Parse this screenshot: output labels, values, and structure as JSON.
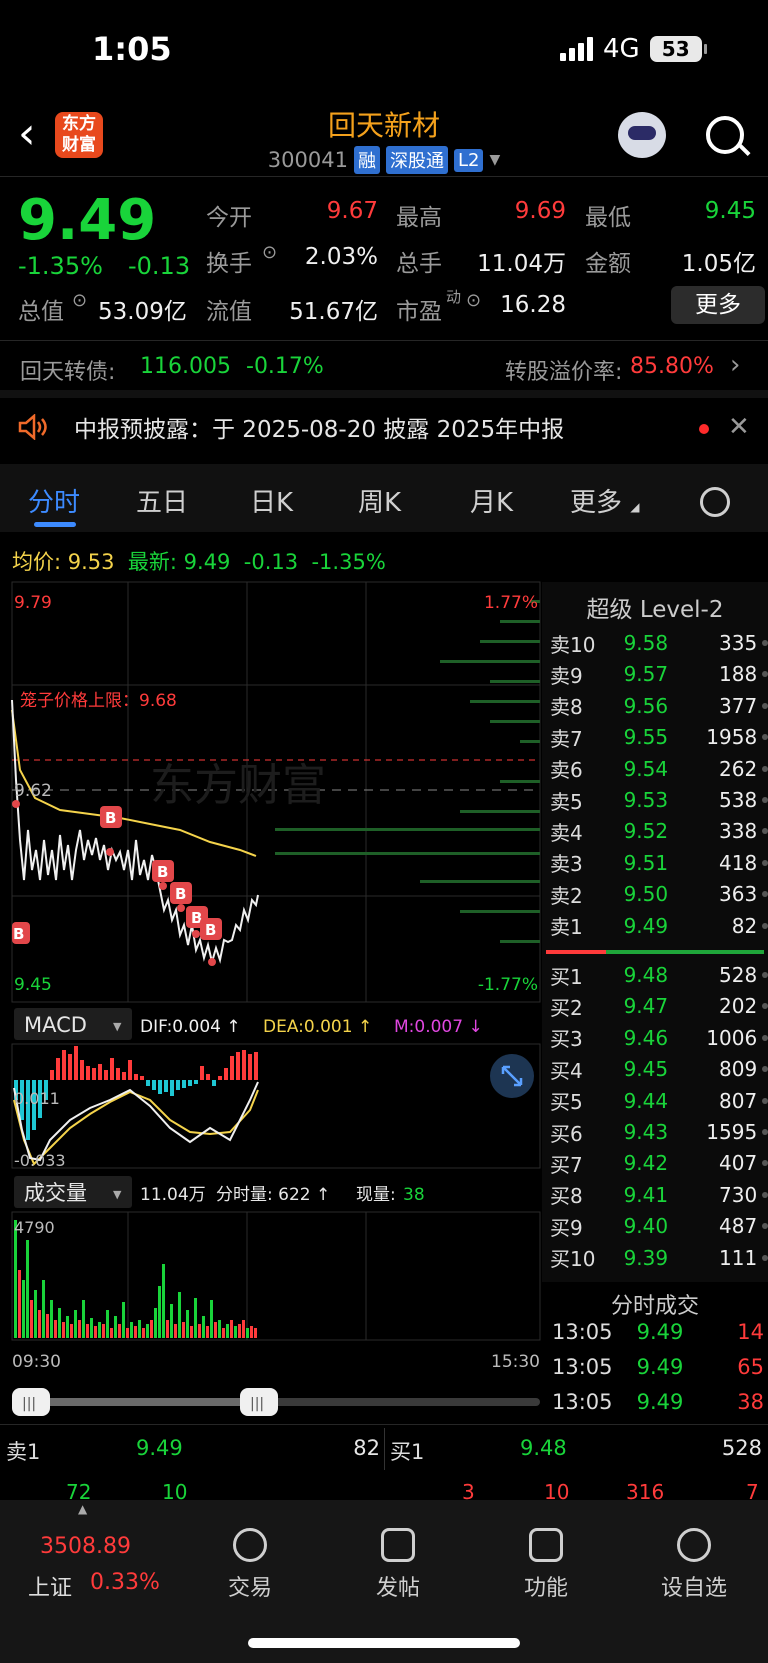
{
  "status": {
    "time": "1:05",
    "network": "4G",
    "battery": "53"
  },
  "header": {
    "title": "回天新材",
    "code": "300041",
    "tags": [
      "融",
      "深股通",
      "L2"
    ],
    "logo_line1": "东方",
    "logo_line2": "财富"
  },
  "quote": {
    "price": "9.49",
    "change_pct": "-1.35%",
    "change": "-0.13",
    "rows": [
      [
        {
          "k": "今开",
          "v": "9.67",
          "c": "red"
        },
        {
          "k": "最高",
          "v": "9.69",
          "c": "red"
        },
        {
          "k": "最低",
          "v": "9.45",
          "c": "green"
        }
      ],
      [
        {
          "k": "换手",
          "v": "2.03%",
          "c": "white"
        },
        {
          "k": "总手",
          "v": "11.04万",
          "c": "white"
        },
        {
          "k": "金额",
          "v": "1.05亿",
          "c": "white"
        }
      ]
    ],
    "row3": {
      "total_value_label": "总值",
      "total_value": "53.09亿",
      "float_label": "流值",
      "float_value": "51.67亿",
      "pe_label": "市盈",
      "pe_sup": "动",
      "pe_value": "16.28"
    },
    "more": "更多"
  },
  "bond": {
    "name": "回天转债:",
    "price": "116.005",
    "pct": "-0.17%",
    "premium_label": "转股溢价率:",
    "premium": "85.80%"
  },
  "notice": {
    "text": "中报预披露：于 2025-08-20 披露 2025年中报"
  },
  "tabs": [
    "分时",
    "五日",
    "日K",
    "周K",
    "月K",
    "更多"
  ],
  "avg_row": {
    "avg_label": "均价:",
    "avg": "9.53",
    "latest_label": "最新:",
    "latest": "9.49",
    "chg": "-0.13",
    "pct": "-1.35%"
  },
  "chart": {
    "price_top": "9.79",
    "price_bottom": "9.45",
    "pct_top": "1.77%",
    "pct_bottom": "-1.77%",
    "ref_price": "9.62",
    "limit_text": "笼子价格上限：9.68",
    "watermark": "东方财富",
    "macd_label": "MACD",
    "dif": "DIF:0.004 ↑",
    "dea": "DEA:0.001 ↑",
    "m": "M:0.007 ↓",
    "macd_top": "0.011",
    "macd_bottom": "-0.033",
    "vol_label": "成交量",
    "vol_total": "11.04万",
    "vol_min": "分时量: 622 ↑",
    "vol_now_label": "现量:",
    "vol_now": "38",
    "vol_top": "4790",
    "time_start": "09:30",
    "time_end": "15:30"
  },
  "level2": {
    "title": "超级 Level-2",
    "asks": [
      {
        "l": "卖10",
        "p": "9.58",
        "v": "335"
      },
      {
        "l": "卖9",
        "p": "9.57",
        "v": "188"
      },
      {
        "l": "卖8",
        "p": "9.56",
        "v": "377"
      },
      {
        "l": "卖7",
        "p": "9.55",
        "v": "1958"
      },
      {
        "l": "卖6",
        "p": "9.54",
        "v": "262"
      },
      {
        "l": "卖5",
        "p": "9.53",
        "v": "538"
      },
      {
        "l": "卖4",
        "p": "9.52",
        "v": "338"
      },
      {
        "l": "卖3",
        "p": "9.51",
        "v": "418"
      },
      {
        "l": "卖2",
        "p": "9.50",
        "v": "363"
      },
      {
        "l": "卖1",
        "p": "9.49",
        "v": "82"
      }
    ],
    "bids": [
      {
        "l": "买1",
        "p": "9.48",
        "v": "528"
      },
      {
        "l": "买2",
        "p": "9.47",
        "v": "202"
      },
      {
        "l": "买3",
        "p": "9.46",
        "v": "1006"
      },
      {
        "l": "买4",
        "p": "9.45",
        "v": "809"
      },
      {
        "l": "买5",
        "p": "9.44",
        "v": "807"
      },
      {
        "l": "买6",
        "p": "9.43",
        "v": "1595"
      },
      {
        "l": "买7",
        "p": "9.42",
        "v": "407"
      },
      {
        "l": "买8",
        "p": "9.41",
        "v": "730"
      },
      {
        "l": "买9",
        "p": "9.40",
        "v": "487"
      },
      {
        "l": "买10",
        "p": "9.39",
        "v": "111"
      }
    ],
    "ticks_title": "分时成交",
    "ticks": [
      {
        "t": "13:05",
        "p": "9.49",
        "v": "14"
      },
      {
        "t": "13:05",
        "p": "9.49",
        "v": "65"
      },
      {
        "t": "13:05",
        "p": "9.49",
        "v": "38"
      }
    ]
  },
  "qbar": {
    "ask_label": "卖1",
    "ask_price": "9.49",
    "ask_vol": "82",
    "bid_label": "买1",
    "bid_price": "9.48",
    "bid_vol": "528",
    "row2": [
      "72",
      "10",
      "3",
      "10",
      "316",
      "7"
    ]
  },
  "bottom": {
    "index_value": "3508.89",
    "index_name": "上证",
    "index_pct": "0.33%",
    "nav": [
      "交易",
      "发帖",
      "功能",
      "设自选"
    ]
  },
  "colors": {
    "up": "#ff3b3b",
    "down": "#19d43a",
    "accent": "#3d8bff",
    "title": "#f4a11c"
  }
}
